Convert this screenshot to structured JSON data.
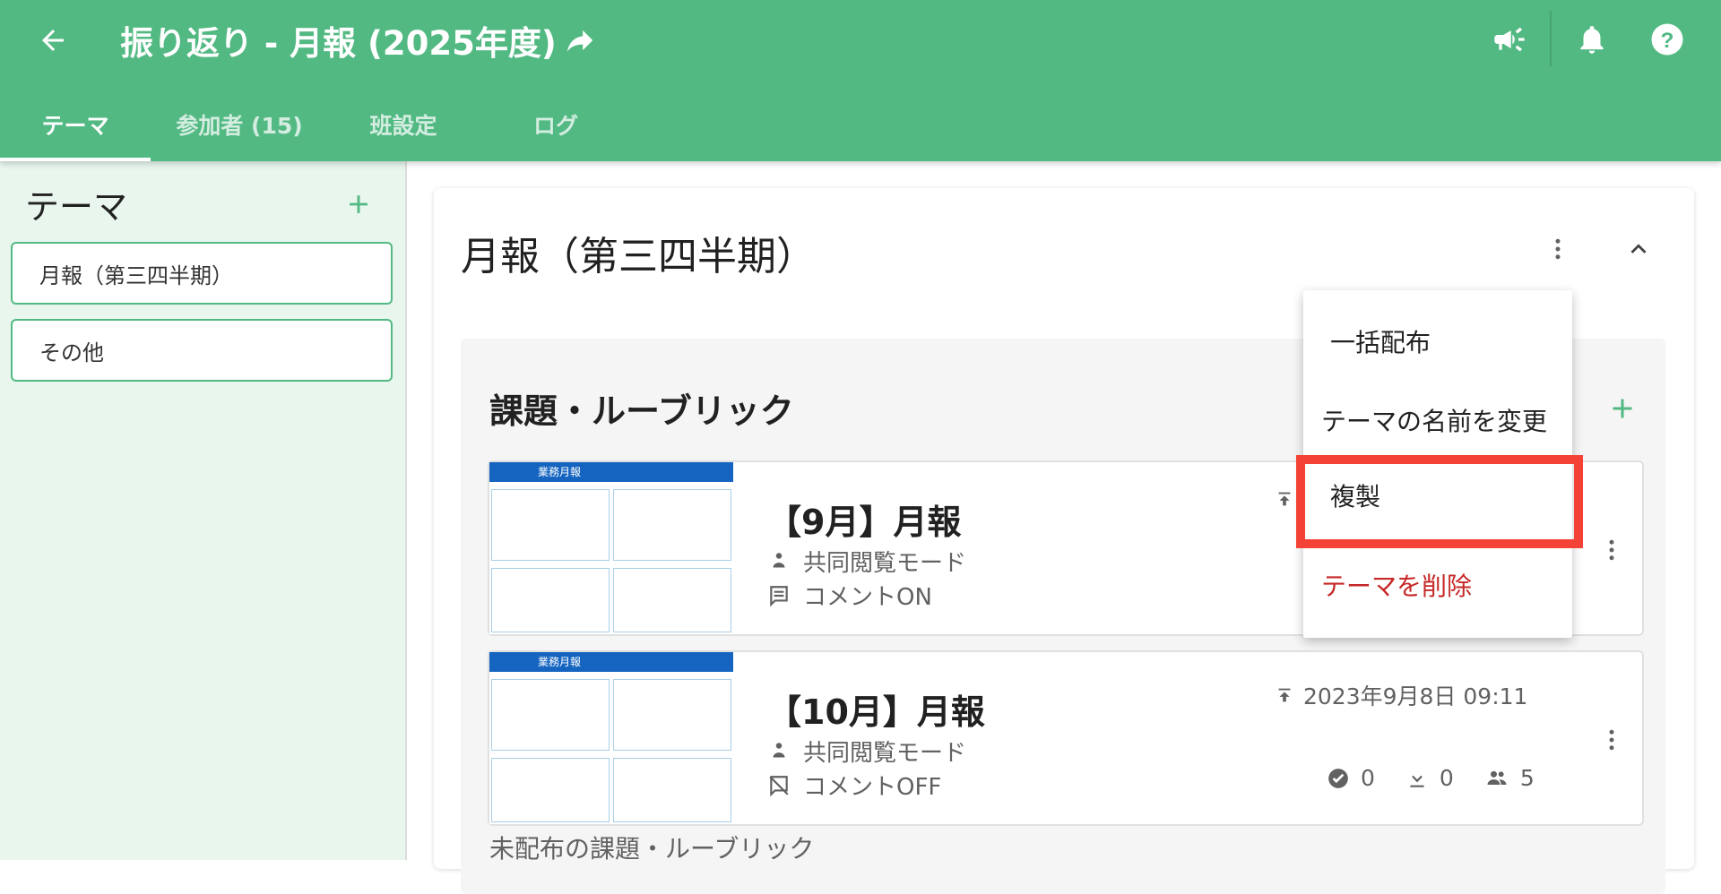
{
  "app_bar": {
    "title": "振り返り - 月報 (2025年度)",
    "accent_color": "#52b983",
    "icons": [
      "arrow-left-icon",
      "share-arrow-icon",
      "megaphone-icon",
      "bell-icon",
      "help-icon"
    ]
  },
  "tabs": [
    {
      "label": "テーマ",
      "active": true
    },
    {
      "label": "参加者 (15)",
      "active": false
    },
    {
      "label": "班設定",
      "active": false
    },
    {
      "label": "ログ",
      "active": false
    }
  ],
  "sidebar": {
    "heading": "テーマ",
    "items": [
      {
        "label": "月報（第三四半期）"
      },
      {
        "label": "その他"
      }
    ]
  },
  "main": {
    "card_title": "月報（第三四半期）",
    "section_title": "課題・ルーブリック",
    "tasks": [
      {
        "thumbnail_title": "業務月報",
        "name": "【9月】月報",
        "mode": "共同閲覧モード",
        "comment": "コメントON",
        "date": "",
        "stats": {
          "approved": "",
          "downloads": "",
          "members": ""
        }
      },
      {
        "thumbnail_title": "業務月報",
        "name": "【10月】月報",
        "mode": "共同閲覧モード",
        "comment": "コメントOFF",
        "date": "2023年9月8日 09:11",
        "stats": {
          "approved": "0",
          "downloads": "0",
          "members": "5"
        }
      }
    ],
    "next_section_label": "未配布の課題・ルーブリック"
  },
  "menu": {
    "items": [
      {
        "label": "一括配布"
      },
      {
        "label": "テーマの名前を変更"
      },
      {
        "label": "複製",
        "highlighted": true
      },
      {
        "label": "テーマを削除",
        "danger": true,
        "color": "#c62828"
      }
    ],
    "highlight_color": "#f44336"
  }
}
